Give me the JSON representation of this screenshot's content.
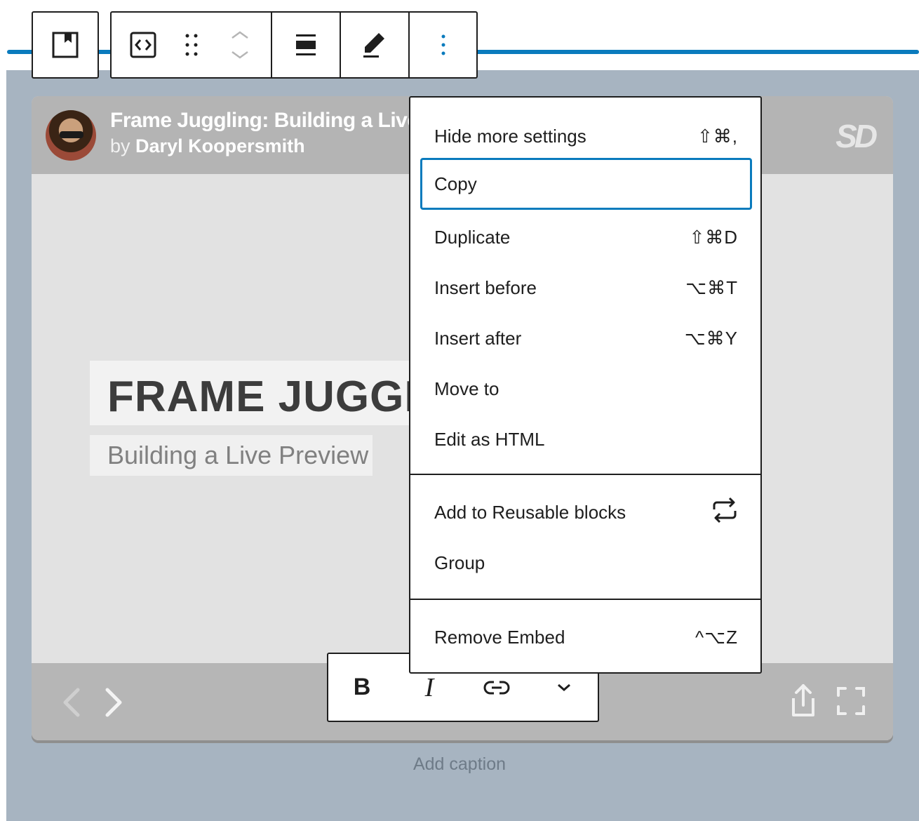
{
  "colors": {
    "accent": "#0a7bbd",
    "canvas": "#a7b4c1",
    "toolbar_border": "#1e1e1e"
  },
  "embed": {
    "title": "Frame Juggling: Building a Live",
    "by_prefix": "by",
    "author": "Daryl Koopersmith",
    "logo_text": "SD",
    "slide_title": "FRAME JUGGLI",
    "slide_subtitle": "Building a Live Preview",
    "prev_arrow": "‹",
    "next_arrow": "›",
    "icons": [
      "share-icon",
      "fullscreen-icon"
    ]
  },
  "caption": {
    "placeholder": "Add caption"
  },
  "block_toolbar": {
    "buttons": [
      "embed-block-icon",
      "html-code-icon",
      "drag-handle-icon",
      "move-up-down-icon",
      "align-icon",
      "edit-pencil-icon",
      "more-options-icon"
    ]
  },
  "menu": {
    "items": [
      {
        "label": "Hide more settings",
        "shortcut": "⇧⌘,"
      },
      {
        "label": "Copy",
        "shortcut": ""
      },
      {
        "label": "Duplicate",
        "shortcut": "⇧⌘D"
      },
      {
        "label": "Insert before",
        "shortcut": "⌥⌘T"
      },
      {
        "label": "Insert after",
        "shortcut": "⌥⌘Y"
      },
      {
        "label": "Move to",
        "shortcut": ""
      },
      {
        "label": "Edit as HTML",
        "shortcut": ""
      }
    ],
    "reusable": {
      "label": "Add to Reusable blocks",
      "icon": "reusable-block-icon"
    },
    "group": {
      "label": "Group"
    },
    "remove": {
      "label": "Remove Embed",
      "shortcut": "^⌥Z"
    }
  },
  "format_toolbar": {
    "bold": "B",
    "italic": "I",
    "link_icon": "link-icon",
    "more_icon": "chevron-down-icon"
  }
}
